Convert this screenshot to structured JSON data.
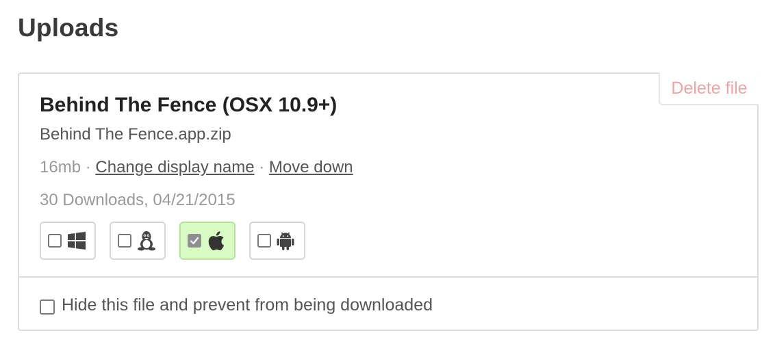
{
  "page": {
    "title": "Uploads"
  },
  "upload": {
    "delete_label": "Delete file",
    "display_name": "Behind The Fence (OSX 10.9+)",
    "filename": "Behind The Fence.app.zip",
    "size": "16mb",
    "separator": "·",
    "change_name_label": "Change display name",
    "move_down_label": "Move down",
    "stats": "30 Downloads, 04/21/2015",
    "platforms": [
      {
        "icon": "windows-icon",
        "checked": false
      },
      {
        "icon": "linux-icon",
        "checked": false
      },
      {
        "icon": "apple-icon",
        "checked": true
      },
      {
        "icon": "android-icon",
        "checked": false
      }
    ],
    "hide_label": "Hide this file and prevent from being downloaded",
    "hide_checked": false
  },
  "colors": {
    "selected_platform_bg": "#d9fbc4",
    "delete_text": "#f0a4a4",
    "link_text": "#555555"
  }
}
